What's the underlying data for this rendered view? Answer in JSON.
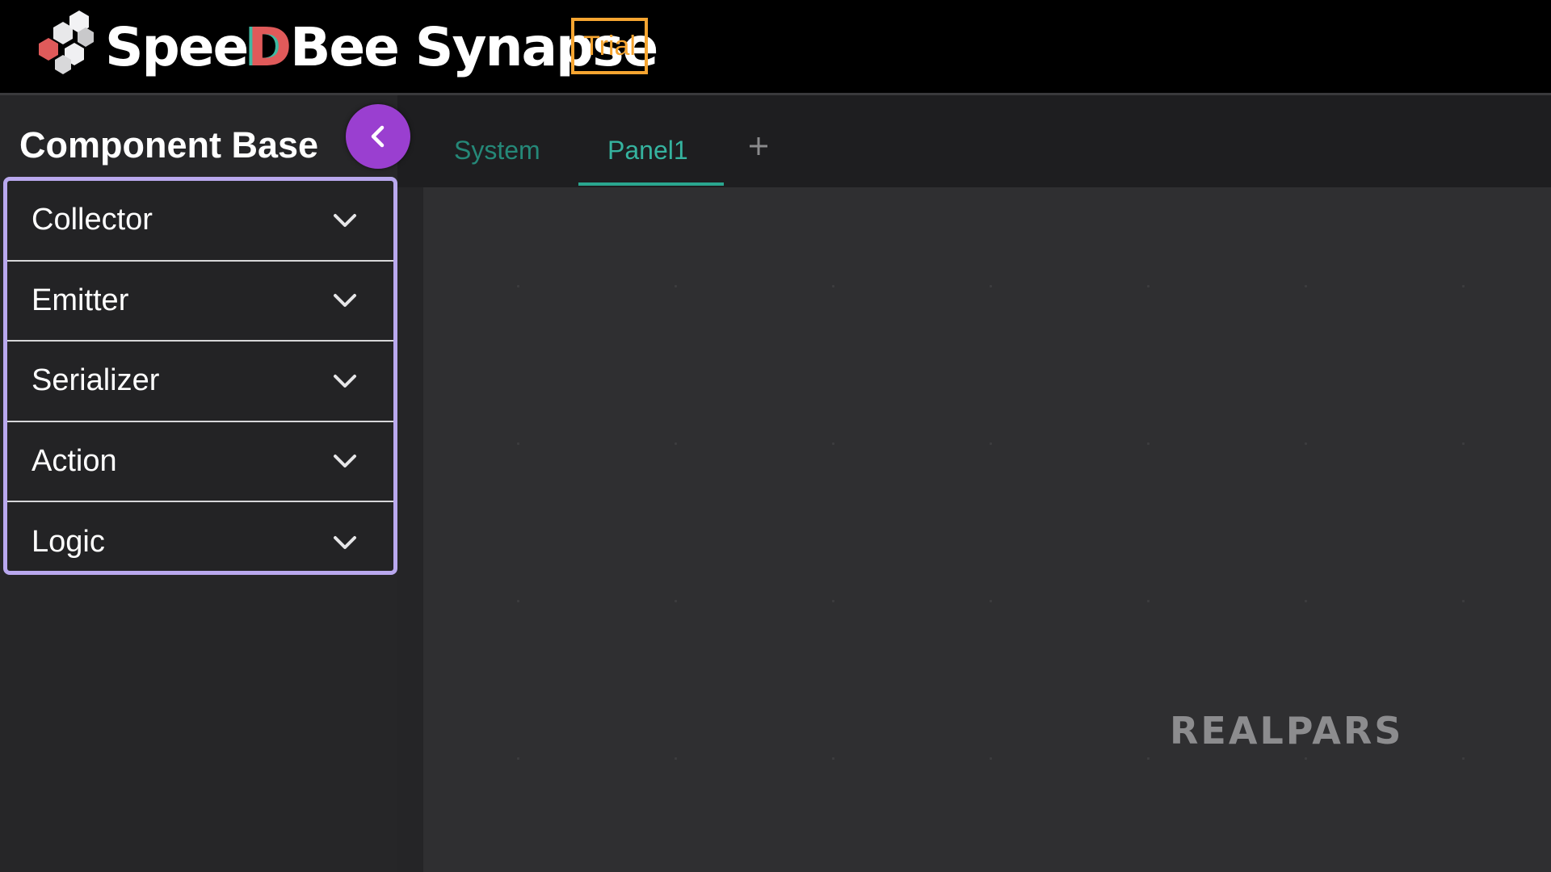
{
  "header": {
    "brand_prefix": "Spee",
    "brand_d": "D",
    "brand_suffix": "Bee Synapse",
    "badge": "Trial"
  },
  "sidebar": {
    "title": "Component Base",
    "collapse_icon": "chevron-left-icon",
    "categories": [
      {
        "label": "Collector"
      },
      {
        "label": "Emitter"
      },
      {
        "label": "Serializer"
      },
      {
        "label": "Action"
      },
      {
        "label": "Logic"
      }
    ]
  },
  "tabs": {
    "items": [
      {
        "label": "System",
        "active": false
      },
      {
        "label": "Panel1",
        "active": true
      }
    ],
    "add_icon": "plus-icon"
  },
  "watermark": "REALPARS",
  "colors": {
    "accent_purple": "#9a3fd0",
    "list_border": "#b9a8ee",
    "badge_orange": "#f6a531",
    "tab_teal": "#2aa68f"
  }
}
